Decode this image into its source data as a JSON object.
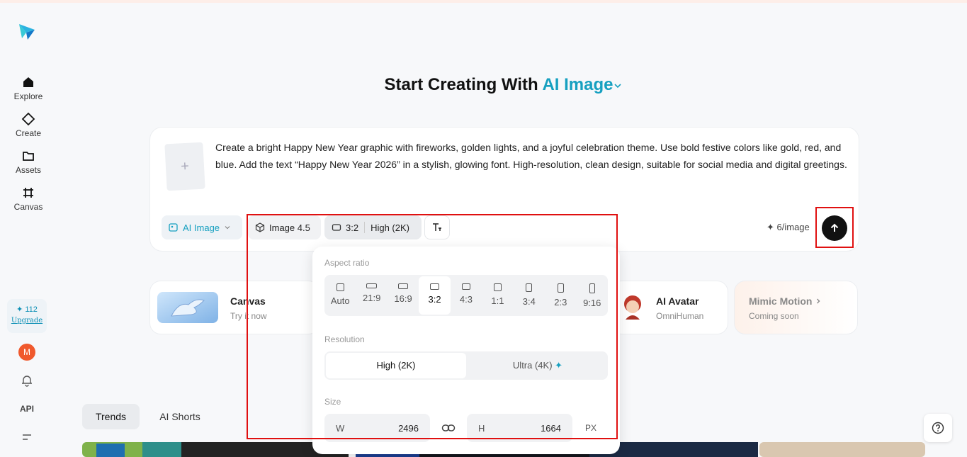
{
  "sidebar": {
    "nav": [
      {
        "label": "Explore",
        "icon": "home-icon"
      },
      {
        "label": "Create",
        "icon": "diamond-icon"
      },
      {
        "label": "Assets",
        "icon": "folder-icon"
      },
      {
        "label": "Canvas",
        "icon": "canvas-grid-icon"
      }
    ],
    "credits": "✦ 112",
    "upgrade_label": "Upgrade",
    "avatar_initial": "M",
    "api_label": "API"
  },
  "heading": {
    "prefix": "Start Creating With",
    "mode": "AI Image"
  },
  "prompt": {
    "add_symbol": "+",
    "text": "Create a bright Happy New Year graphic with fireworks, golden lights, and a joyful celebration theme. Use bold festive colors like gold, red, and blue. Add the text “Happy New Year 2026” in a stylish, glowing font. High-resolution, clean design, suitable for social media and digital greetings.",
    "mode_chip": "AI Image",
    "model_chip": "Image 4.5",
    "ratio_chip": "3:2",
    "quality_chip": "High (2K)",
    "price": "✦ 6/image"
  },
  "features": [
    {
      "title": "Canvas",
      "subtitle": "Try it now"
    },
    {
      "title": "AI Avatar",
      "subtitle": "OmniHuman"
    },
    {
      "title": "Mimic Motion",
      "subtitle": "Coming soon"
    }
  ],
  "tabs": [
    "Trends",
    "AI Shorts"
  ],
  "popup": {
    "aspect_label": "Aspect ratio",
    "ratios": [
      "Auto",
      "21:9",
      "16:9",
      "3:2",
      "4:3",
      "1:1",
      "3:4",
      "2:3",
      "9:16"
    ],
    "selected_ratio": "3:2",
    "resolution_label": "Resolution",
    "resolutions": [
      "High (2K)",
      "Ultra (4K)"
    ],
    "selected_resolution": "High (2K)",
    "size_label": "Size",
    "width_label": "W",
    "width_value": "2496",
    "height_label": "H",
    "height_value": "1664",
    "unit": "PX"
  },
  "colors": {
    "accent": "#16a0c0",
    "highlight_box": "#e01010"
  }
}
